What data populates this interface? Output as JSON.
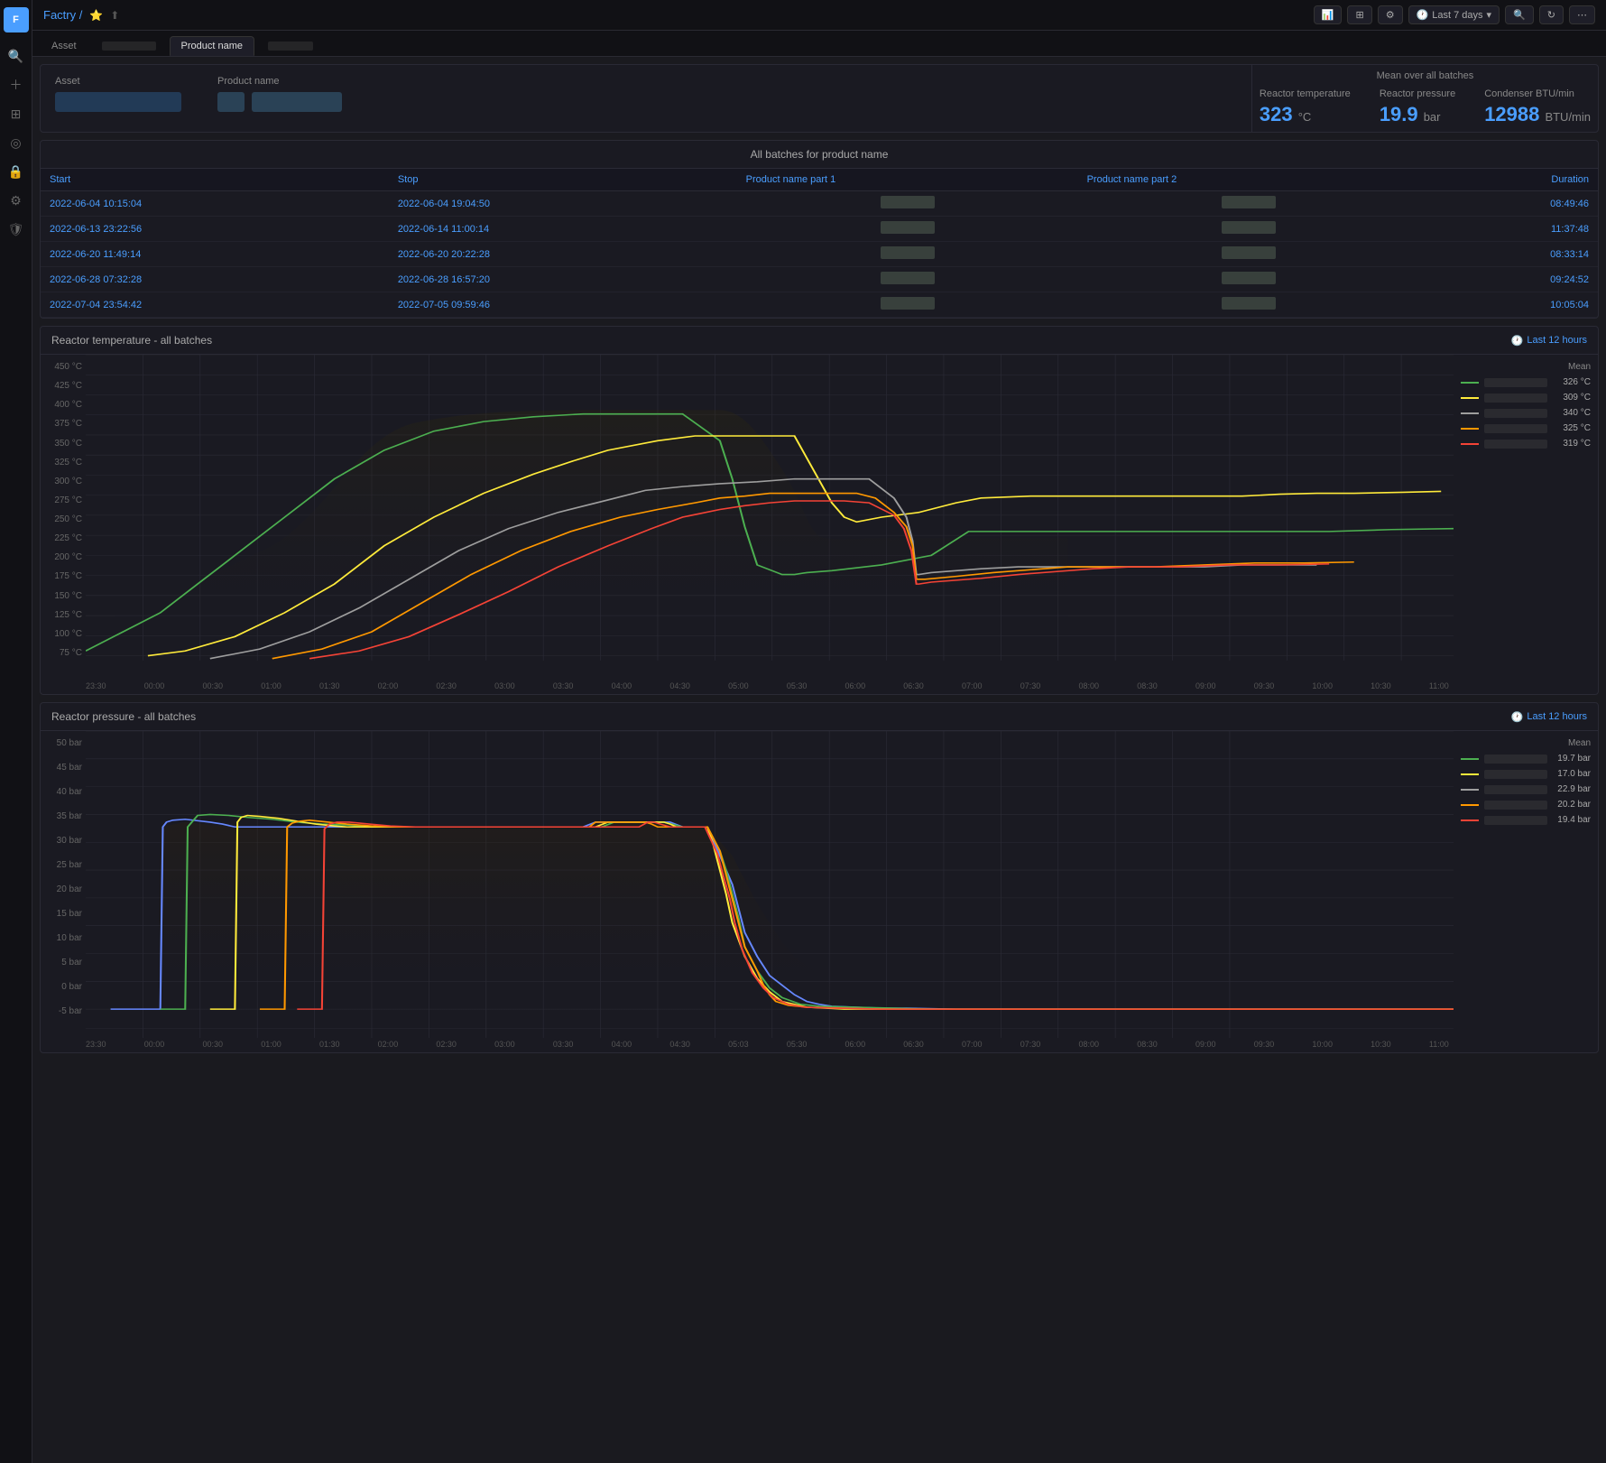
{
  "app": {
    "logo": "F",
    "breadcrumb": "Factry /",
    "star_icon": "★",
    "share_icon": "⬆"
  },
  "topbar": {
    "time_range": "Last 7 days",
    "buttons": [
      "chart-icon",
      "table-icon",
      "settings-icon",
      "refresh-icon",
      "expand-icon"
    ]
  },
  "tabs": [
    {
      "id": "asset",
      "label": "Asset",
      "active": false
    },
    {
      "id": "batch",
      "label": "",
      "active": false
    },
    {
      "id": "product",
      "label": "Product name",
      "active": true
    },
    {
      "id": "custom",
      "label": "",
      "active": false
    }
  ],
  "info_card": {
    "asset_label": "Asset",
    "product_label": "Product name",
    "mean_header": "Mean over all batches",
    "metrics": [
      {
        "label": "Reactor temperature",
        "value": "323",
        "unit": "°C"
      },
      {
        "label": "Reactor pressure",
        "value": "19.9",
        "unit": "bar"
      },
      {
        "label": "Condenser BTU/min",
        "value": "12988",
        "unit": "BTU/min"
      }
    ]
  },
  "batches_table": {
    "section_title": "All batches for product name",
    "columns": [
      "Start",
      "Stop",
      "Product name part 1",
      "Product name part 2",
      "Duration"
    ],
    "rows": [
      {
        "start": "2022-06-04 10:15:04",
        "stop": "2022-06-04 19:04:50",
        "duration": "08:49:46"
      },
      {
        "start": "2022-06-13 23:22:56",
        "stop": "2022-06-14 11:00:14",
        "duration": "11:37:48"
      },
      {
        "start": "2022-06-20 11:49:14",
        "stop": "2022-06-20 20:22:28",
        "duration": "08:33:14"
      },
      {
        "start": "2022-06-28 07:32:28",
        "stop": "2022-06-28 16:57:20",
        "duration": "09:24:52"
      },
      {
        "start": "2022-07-04 23:54:42",
        "stop": "2022-07-05 09:59:46",
        "duration": "10:05:04"
      }
    ]
  },
  "temp_chart": {
    "title": "Reactor temperature - all batches",
    "time_badge": "Last 12 hours",
    "y_axis": [
      "450 °C",
      "425 °C",
      "400 °C",
      "375 °C",
      "350 °C",
      "325 °C",
      "300 °C",
      "275 °C",
      "250 °C",
      "225 °C",
      "200 °C",
      "175 °C",
      "150 °C",
      "125 °C",
      "100 °C",
      "75 °C"
    ],
    "x_axis": [
      "23:30",
      "00:00",
      "00:30",
      "01:00",
      "01:30",
      "02:00",
      "02:30",
      "03:00",
      "03:30",
      "04:00",
      "04:30",
      "05:00",
      "05:30",
      "06:00",
      "06:30",
      "07:00",
      "07:30",
      "08:00",
      "08:30",
      "09:00",
      "09:30",
      "10:00",
      "10:30",
      "11:00"
    ],
    "mean_label": "Mean",
    "legend": [
      {
        "color": "#4CAF50",
        "value": "326 °C"
      },
      {
        "color": "#FFEB3B",
        "value": "309 °C"
      },
      {
        "color": "#9E9E9E",
        "value": "340 °C"
      },
      {
        "color": "#FF9800",
        "value": "325 °C"
      },
      {
        "color": "#F44336",
        "value": "319 °C"
      }
    ]
  },
  "pressure_chart": {
    "title": "Reactor pressure - all batches",
    "time_badge": "Last 12 hours",
    "y_axis": [
      "50 bar",
      "45 bar",
      "40 bar",
      "35 bar",
      "30 bar",
      "25 bar",
      "20 bar",
      "15 bar",
      "10 bar",
      "5 bar",
      "0 bar",
      "-5 bar"
    ],
    "x_axis": [
      "23:30",
      "00:00",
      "00:30",
      "01:00",
      "01:30",
      "02:00",
      "02:30",
      "03:00",
      "03:30",
      "04:00",
      "04:30",
      "05:03",
      "05:30",
      "06:00",
      "06:30",
      "07:00",
      "07:30",
      "08:00",
      "08:30",
      "09:00",
      "09:30",
      "10:00",
      "10:30",
      "11:00"
    ],
    "mean_label": "Mean",
    "legend": [
      {
        "color": "#4CAF50",
        "value": "19.7 bar"
      },
      {
        "color": "#FFEB3B",
        "value": "17.0 bar"
      },
      {
        "color": "#9E9E9E",
        "value": "22.9 bar"
      },
      {
        "color": "#FF9800",
        "value": "20.2 bar"
      },
      {
        "color": "#F44336",
        "value": "19.4 bar"
      }
    ]
  },
  "sidebar": {
    "icons": [
      {
        "name": "search-icon",
        "glyph": "🔍"
      },
      {
        "name": "add-icon",
        "glyph": "+"
      },
      {
        "name": "grid-icon",
        "glyph": "⊞"
      },
      {
        "name": "target-icon",
        "glyph": "◎"
      },
      {
        "name": "lock-icon",
        "glyph": "🔒"
      },
      {
        "name": "settings-icon",
        "glyph": "⚙"
      },
      {
        "name": "shield-icon",
        "glyph": "🛡"
      }
    ]
  }
}
